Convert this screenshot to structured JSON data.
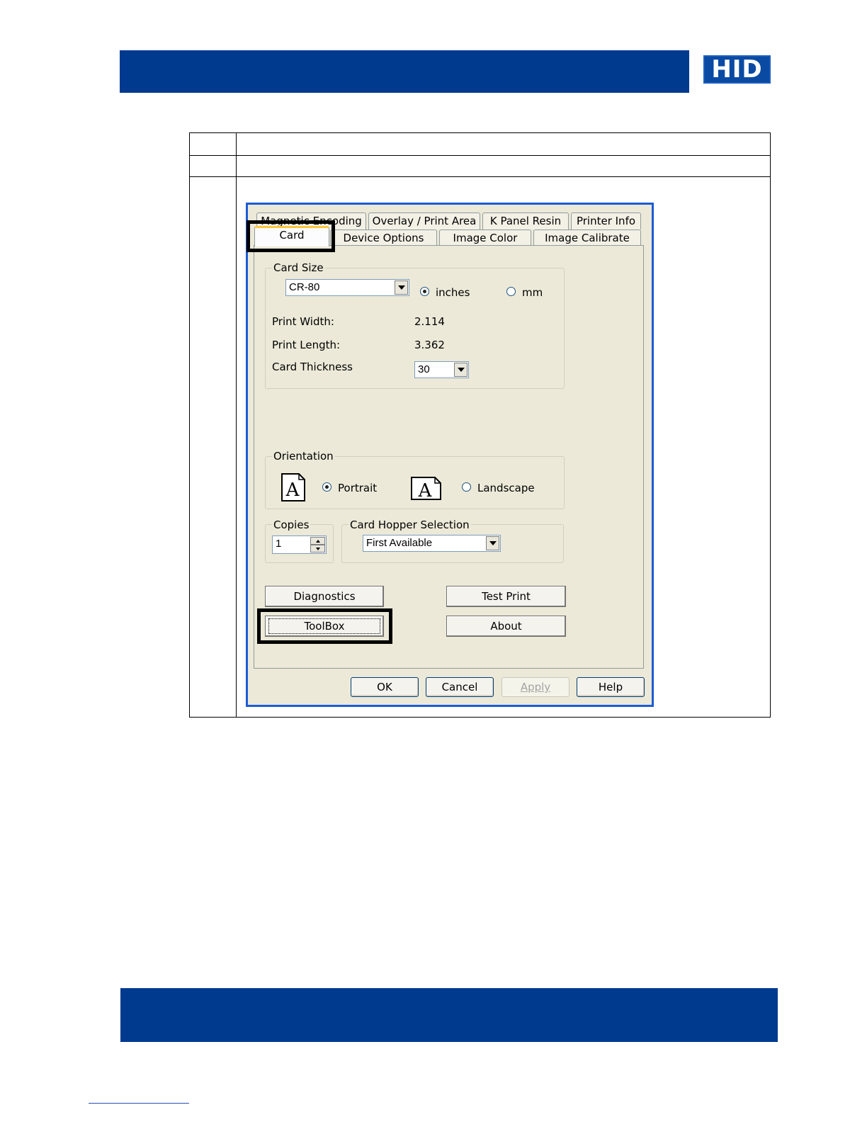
{
  "header": {
    "brand_logo_text": "HID",
    "colors": {
      "bar": "#003a8f",
      "logo_bg": "#0a4aa3"
    }
  },
  "dialog": {
    "tabs_back_row": [
      "Magnetic Encoding",
      "Overlay / Print Area",
      "K Panel Resin",
      "Printer Info"
    ],
    "tabs_front_row": [
      "Card",
      "Device Options",
      "Image Color",
      "Image Calibrate"
    ],
    "active_tab": "Card",
    "card_size": {
      "title": "Card Size",
      "size_value": "CR-80",
      "unit_inches": "inches",
      "unit_mm": "mm",
      "selected_unit": "inches",
      "print_width_label": "Print Width:",
      "print_width_value": "2.114",
      "print_length_label": "Print Length:",
      "print_length_value": "3.362",
      "thickness_label": "Card Thickness",
      "thickness_value": "30"
    },
    "orientation": {
      "title": "Orientation",
      "portrait": "Portrait",
      "landscape": "Landscape",
      "icon_glyph": "A",
      "selected": "Portrait"
    },
    "copies": {
      "title": "Copies",
      "value": "1"
    },
    "hopper": {
      "title": "Card Hopper Selection",
      "value": "First Available"
    },
    "buttons": {
      "diagnostics": "Diagnostics",
      "test_print": "Test Print",
      "toolbox": "ToolBox",
      "about": "About",
      "ok": "OK",
      "cancel": "Cancel",
      "apply": "Apply",
      "help": "Help"
    }
  }
}
